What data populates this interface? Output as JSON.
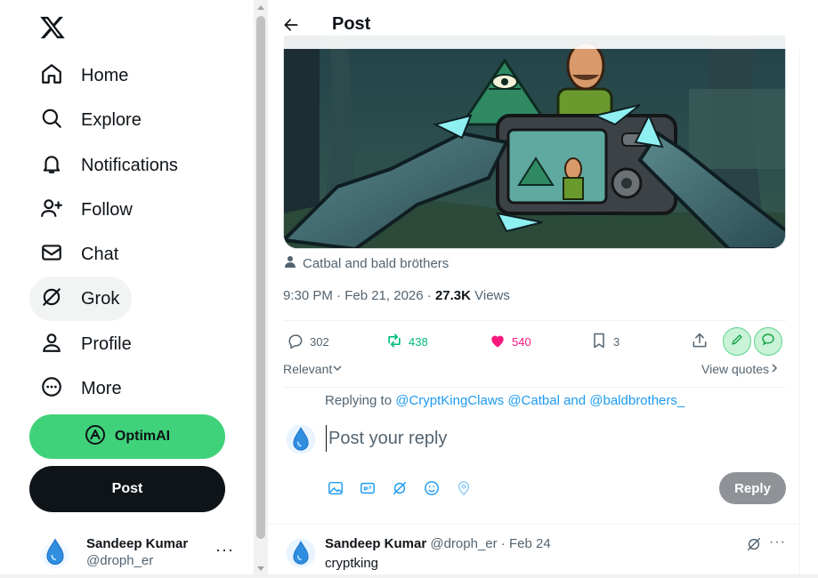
{
  "sidebar": {
    "logo": "x-logo-icon",
    "nav": [
      {
        "label": "Home",
        "icon": "home-icon"
      },
      {
        "label": "Explore",
        "icon": "search-icon"
      },
      {
        "label": "Notifications",
        "icon": "bell-icon"
      },
      {
        "label": "Follow",
        "icon": "add-person-icon"
      },
      {
        "label": "Chat",
        "icon": "envelope-icon"
      },
      {
        "label": "Grok",
        "icon": "grok-icon"
      },
      {
        "label": "Profile",
        "icon": "person-icon"
      },
      {
        "label": "More",
        "icon": "more-circle-icon"
      }
    ],
    "optimai_label": "OptimAI",
    "post_label": "Post",
    "account": {
      "name": "Sandeep Kumar",
      "handle": "@droph_er",
      "more": "···"
    }
  },
  "header": {
    "title": "Post"
  },
  "post": {
    "caption": "Catbal and bald bröthers",
    "time": "9:30 PM · Feb 21, 2026 · ",
    "views_count": "27.3K",
    "views_label": " Views",
    "stats": {
      "replies": "302",
      "reposts": "438",
      "likes": "540",
      "bookmarks": "3"
    }
  },
  "replies_bar": {
    "sort_label": "Relevant",
    "quotes_label": "View quotes"
  },
  "composer": {
    "replying_prefix": "Replying to ",
    "mentions": "@CryptKingClaws @Catbal and @baldbrothers_",
    "placeholder": "Post your reply",
    "reply_label": "Reply"
  },
  "comment": {
    "name": "Sandeep Kumar",
    "handle_date": " @droph_er · Feb 24",
    "text": "cryptking"
  },
  "colors": {
    "accent": "#1d9bf0",
    "like": "#f91880",
    "repost": "#00ba7c",
    "optimai": "#3fd27a"
  }
}
